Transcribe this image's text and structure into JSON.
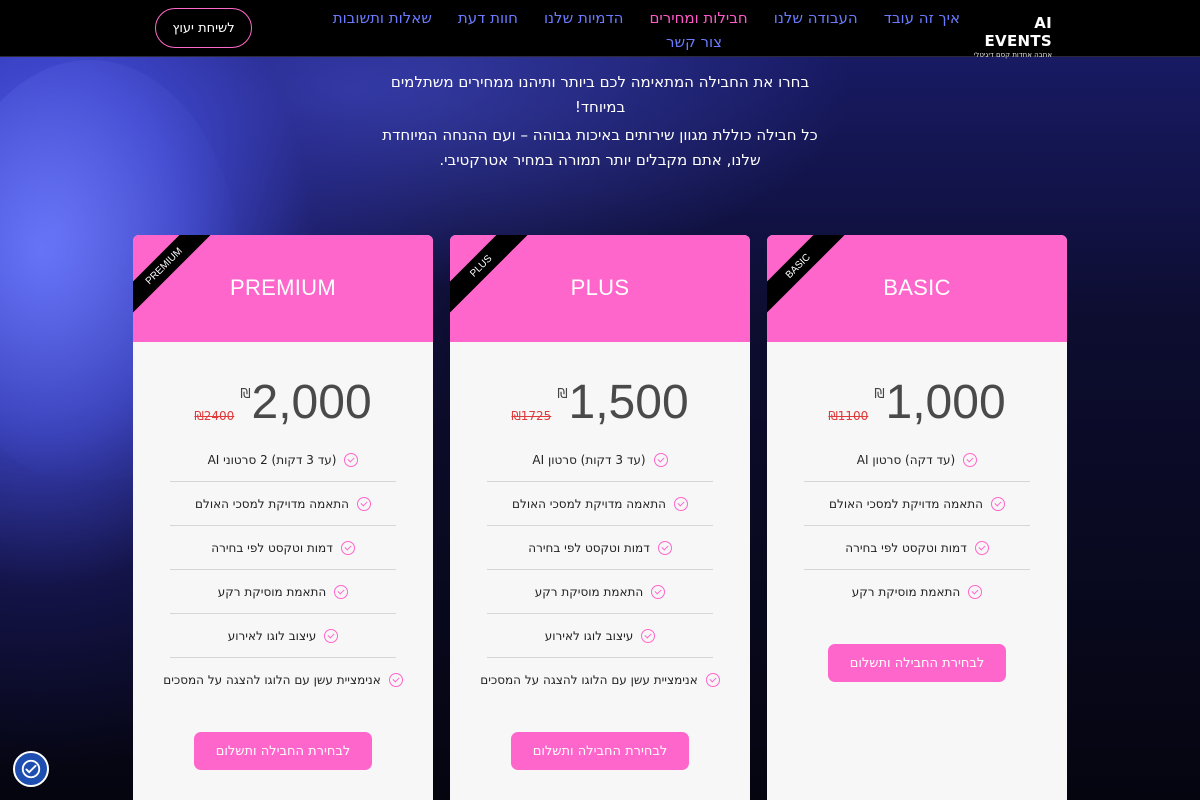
{
  "header": {
    "logo_title": "AI EVENTS",
    "logo_subtitle": "אחבה אחדות קסם דיגיטלי",
    "nav_row1": [
      "איך זה עובד",
      "העבודה שלנו",
      "חבילות ומחירים",
      "הדמיות שלנו",
      "חוות דעת",
      "שאלות ותשובות"
    ],
    "nav_row2": [
      "צור קשר"
    ],
    "active_nav": "חבילות ומחירים",
    "consult_button": "לשיחת יעוץ"
  },
  "intro": {
    "line1": "בחרו את החבילה המתאימה לכם ביותר ותיהנו ממחירים משתלמים במיוחד!",
    "line2": "כל חבילה כוללת מגוון שירותים באיכות גבוהה – ועם ההנחה המיוחדת שלנו, אתם מקבלים יותר תמורה במחיר אטרקטיבי."
  },
  "plans": [
    {
      "ribbon": "PREMIUM",
      "title": "PREMIUM",
      "currency": "₪",
      "price": "2,000",
      "old_price": "₪2400",
      "features": [
        "(עד 3 דקות) 2 סרטוני AI",
        "התאמה מדויקת למסכי האולם",
        "דמות וטקסט לפי בחירה",
        "התאמת מוסיקת רקע",
        "עיצוב לוגו לאירוע",
        "אנימציית עשן עם הלוגו להצגה על המסכים"
      ],
      "cta": "לבחירת החבילה ותשלום"
    },
    {
      "ribbon": "PLUS",
      "title": "PLUS",
      "currency": "₪",
      "price": "1,500",
      "old_price": "₪1725",
      "features": [
        "(עד 3 דקות) סרטון AI",
        "התאמה מדויקת למסכי האולם",
        "דמות וטקסט לפי בחירה",
        "התאמת מוסיקת רקע",
        "עיצוב לוגו לאירוע",
        "אנימציית עשן עם הלוגו להצגה על המסכים"
      ],
      "cta": "לבחירת החבילה ותשלום"
    },
    {
      "ribbon": "BASIC",
      "title": "BASIC",
      "currency": "₪",
      "price": "1,000",
      "old_price": "₪1100",
      "features": [
        "(עד דקה) סרטון AI",
        "התאמה מדויקת למסכי האולם",
        "דמות וטקסט לפי בחירה",
        "התאמת מוסיקת רקע"
      ],
      "cta": "לבחירת החבילה ותשלום"
    }
  ],
  "accessibility_icon": "accessibility-icon",
  "colors": {
    "accent_pink": "#ff66cc",
    "nav_blue": "#6a7bff",
    "old_price_red": "#e03b3b"
  }
}
